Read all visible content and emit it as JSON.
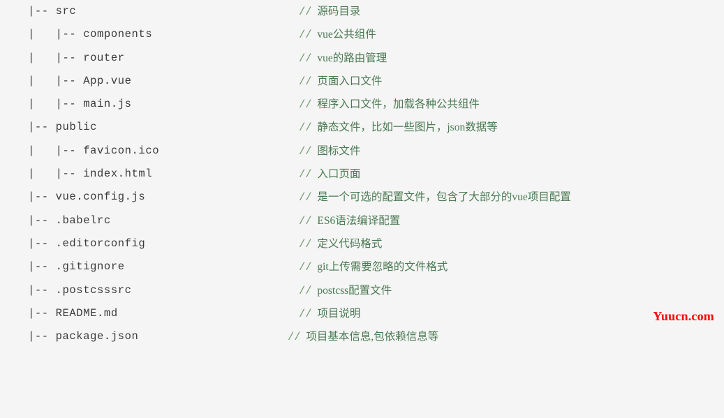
{
  "page": {
    "background_color": "#f5f5f5",
    "path_color": "#3a3a3a",
    "comment_color": "#4a7a52",
    "watermark_color": "#ff0000"
  },
  "watermark": {
    "text": "Yuucn.com"
  },
  "tree": {
    "lines": [
      {
        "path": "|-- src",
        "comment_marker": "//",
        "comment": "源码目录"
      },
      {
        "path": "|   |-- components",
        "comment_marker": "//",
        "comment": "vue公共组件"
      },
      {
        "path": "|   |-- router",
        "comment_marker": "//",
        "comment": "vue的路由管理"
      },
      {
        "path": "|   |-- App.vue",
        "comment_marker": "//",
        "comment": "页面入口文件"
      },
      {
        "path": "|   |-- main.js",
        "comment_marker": "//",
        "comment": "程序入口文件，加载各种公共组件"
      },
      {
        "path": "|-- public",
        "comment_marker": "//",
        "comment": "静态文件，比如一些图片，json数据等"
      },
      {
        "path": "|   |-- favicon.ico",
        "comment_marker": "//",
        "comment": "图标文件"
      },
      {
        "path": "|   |-- index.html",
        "comment_marker": "//",
        "comment": "入口页面"
      },
      {
        "path": "|-- vue.config.js",
        "comment_marker": "//",
        "comment": "是一个可选的配置文件，包含了大部分的vue项目配置"
      },
      {
        "path": "|-- .babelrc",
        "comment_marker": "//",
        "comment": "ES6语法编译配置"
      },
      {
        "path": "|-- .editorconfig",
        "comment_marker": "//",
        "comment": "定义代码格式"
      },
      {
        "path": "|-- .gitignore",
        "comment_marker": "//",
        "comment": "git上传需要忽略的文件格式"
      },
      {
        "path": "|-- .postcsssrc",
        "comment_marker": "//",
        "comment": "postcss配置文件"
      },
      {
        "path": "|-- README.md",
        "comment_marker": "//",
        "comment": "项目说明"
      },
      {
        "path": "|-- package.json",
        "comment_marker": "//",
        "comment": "项目基本信息,包依赖信息等"
      }
    ]
  }
}
